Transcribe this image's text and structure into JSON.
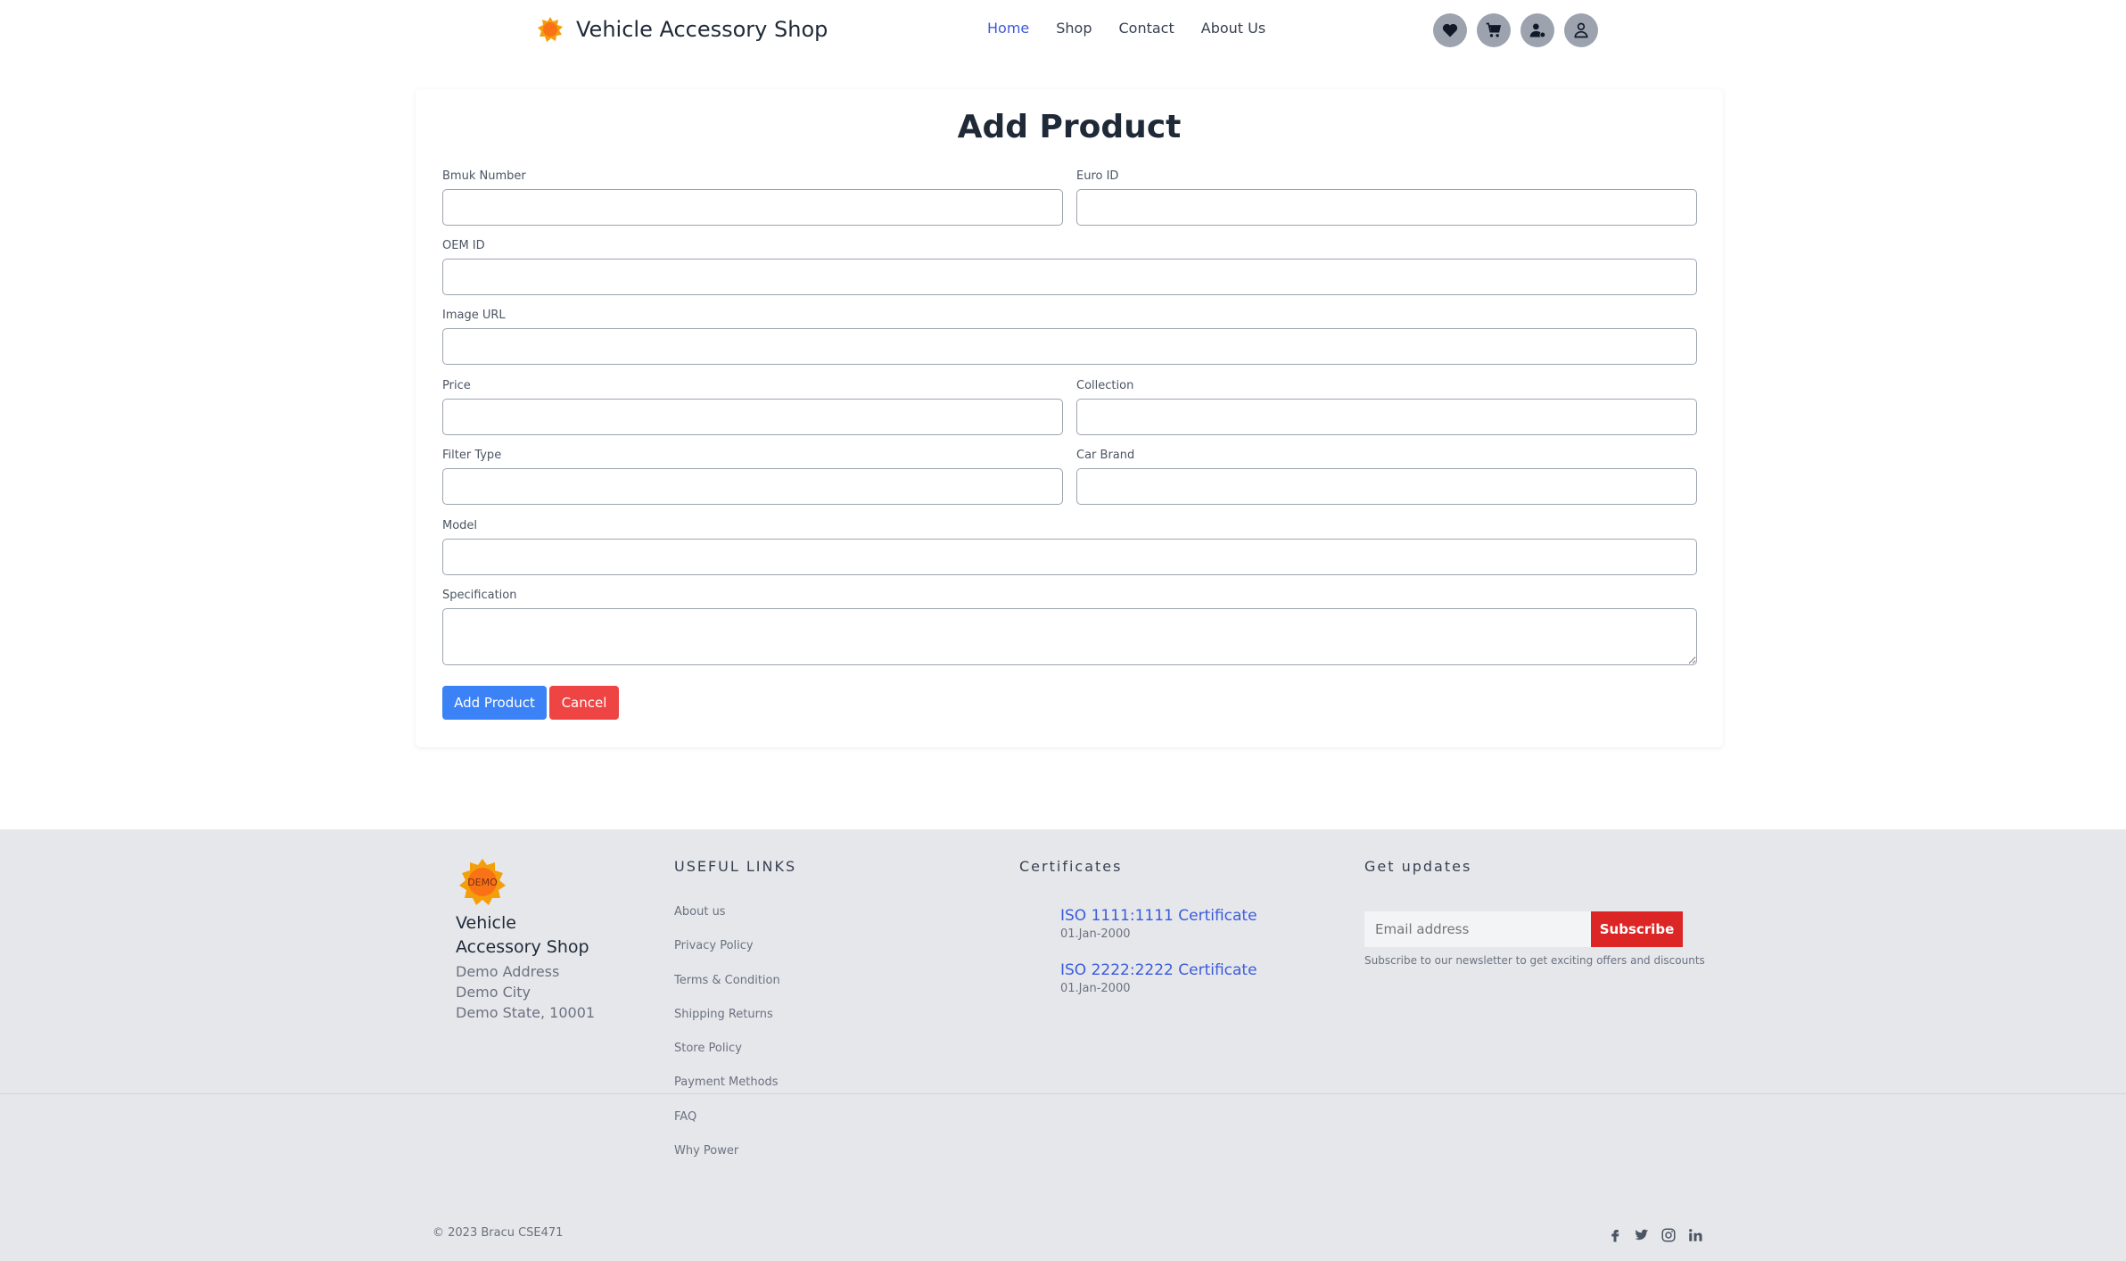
{
  "header": {
    "brand_name": "Vehicle Accessory Shop",
    "nav": [
      "Home",
      "Shop",
      "Contact",
      "About Us"
    ],
    "icons": [
      "heart-icon",
      "cart-icon",
      "user-settings-icon",
      "user-icon"
    ]
  },
  "form": {
    "title": "Add Product",
    "fields": {
      "bmuk": "Bmuk Number",
      "euro": "Euro ID",
      "oem": "OEM ID",
      "image": "Image URL",
      "price": "Price",
      "collection": "Collection",
      "filter": "Filter Type",
      "brand": "Car Brand",
      "model": "Model",
      "spec": "Specification"
    },
    "submit_label": "Add Product",
    "cancel_label": "Cancel"
  },
  "footer": {
    "brand_name": "Vehicle Accessory Shop",
    "logo_text": "DEMO",
    "address": [
      "Demo Address",
      "Demo City",
      "Demo State, 10001"
    ],
    "useful_links_heading": "USEFUL LINKS",
    "useful_links": [
      "About us",
      "Privacy Policy",
      "Terms & Condition",
      "Shipping Returns",
      "Store Policy",
      "Payment Methods",
      "FAQ",
      "Why Power"
    ],
    "certificates_heading": "Certificates",
    "certificates": [
      {
        "title": "ISO 1111:1111 Certificate",
        "date": "01.Jan-2000"
      },
      {
        "title": "ISO 2222:2222 Certificate",
        "date": "01.Jan-2000"
      }
    ],
    "updates_heading": "Get updates",
    "email_placeholder": "Email address",
    "subscribe_label": "Subscribe",
    "subscribe_note": "Subscribe to our newsletter to get exciting offers and discounts",
    "copyright": "© 2023 Bracu CSE471",
    "social": [
      "facebook-icon",
      "twitter-icon",
      "instagram-icon",
      "linkedin-icon"
    ]
  },
  "colors": {
    "accent": "#3b82f6",
    "danger": "#ef4444",
    "subscribe": "#dc2626",
    "link": "#3b5bdb",
    "footer_bg": "#e5e7eb"
  }
}
